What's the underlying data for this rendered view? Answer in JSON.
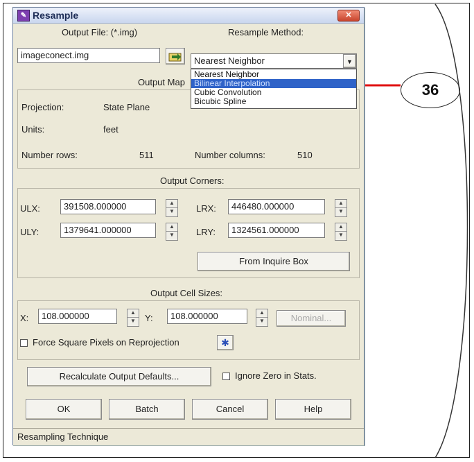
{
  "dialog": {
    "title": "Resample",
    "output_file_label": "Output File: (*.img)",
    "output_file_value": "imageconect.img",
    "resample_method_label": "Resample Method:",
    "resample_method_value": "Nearest Neighbor",
    "method_options": [
      "Nearest Neighbor",
      "Bilinear Interpolation",
      "Cubic Convolution",
      "Bicubic Spline"
    ],
    "output_map_label": "Output Map",
    "projection_label": "Projection:",
    "projection_value": "State Plane",
    "units_label": "Units:",
    "units_value": "feet",
    "rows_label": "Number rows:",
    "rows_value": "511",
    "cols_label": "Number columns:",
    "cols_value": "510",
    "output_corners_label": "Output Corners:",
    "ulx_label": "ULX:",
    "ulx_value": "391508.000000",
    "uly_label": "ULY:",
    "uly_value": "1379641.000000",
    "lrx_label": "LRX:",
    "lrx_value": "446480.000000",
    "lry_label": "LRY:",
    "lry_value": "1324561.000000",
    "from_inquire_label": "From Inquire Box",
    "cell_sizes_label": "Output Cell Sizes:",
    "x_label": "X:",
    "x_value": "108.000000",
    "y_label": "Y:",
    "y_value": "108.000000",
    "nominal_label": "Nominal...",
    "force_square_label": "Force Square Pixels on Reprojection",
    "recalc_label": "Recalculate Output Defaults...",
    "ignore_zero_label": "Ignore Zero in Stats.",
    "ok_label": "OK",
    "batch_label": "Batch",
    "cancel_label": "Cancel",
    "help_label": "Help",
    "status_text": "Resampling Technique"
  },
  "callout": {
    "number": "36",
    "arrow_color": "#e01010"
  }
}
